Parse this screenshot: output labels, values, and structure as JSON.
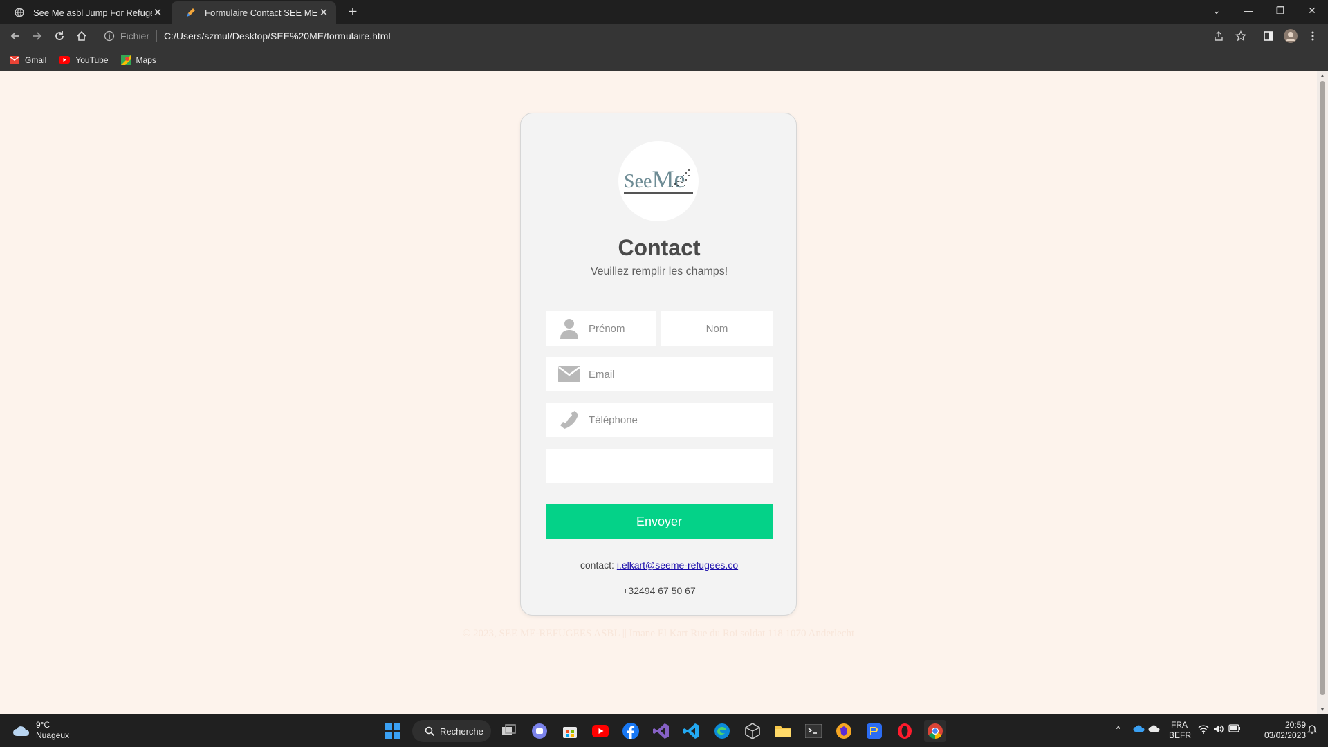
{
  "browser": {
    "tabs": [
      {
        "label": "See Me asbl Jump For Refugees",
        "active": false
      },
      {
        "label": "Formulaire Contact SEE ME ASBL",
        "active": true
      }
    ],
    "address": {
      "scheme_label": "Fichier",
      "url": "C:/Users/szmul/Desktop/SEE%20ME/formulaire.html"
    },
    "bookmarks": [
      {
        "label": "Gmail",
        "icon": "gmail-icon"
      },
      {
        "label": "YouTube",
        "icon": "youtube-icon"
      },
      {
        "label": "Maps",
        "icon": "maps-icon"
      }
    ]
  },
  "page": {
    "logo": {
      "see": "See",
      "me": "Me"
    },
    "title": "Contact",
    "subtitle": "Veuillez remplir les champs!",
    "form": {
      "first_name_placeholder": "Prénom",
      "last_name_placeholder": "Nom",
      "email_placeholder": "Email",
      "phone_placeholder": "Téléphone",
      "message_placeholder": "",
      "submit_label": "Envoyer"
    },
    "contact": {
      "prefix": "contact:",
      "email": "i.elkart@seeme-refugees.co",
      "phone": "+32494 67 50 67"
    },
    "footer": "© 2023, SEE ME-REFUGEES ASBL || Imane El Kart Rue du Roi soldat 118 1070 Anderlecht"
  },
  "taskbar": {
    "weather": {
      "temp": "9°C",
      "condition": "Nuageux"
    },
    "search_label": "Recherche",
    "language": {
      "lang": "FRA",
      "layout": "BEFR"
    },
    "clock": {
      "time": "20:59",
      "date": "03/02/2023"
    }
  },
  "colors": {
    "accent": "#04d288",
    "page_bg": "#fdf3ec",
    "card_bg": "#f3f3f3"
  }
}
